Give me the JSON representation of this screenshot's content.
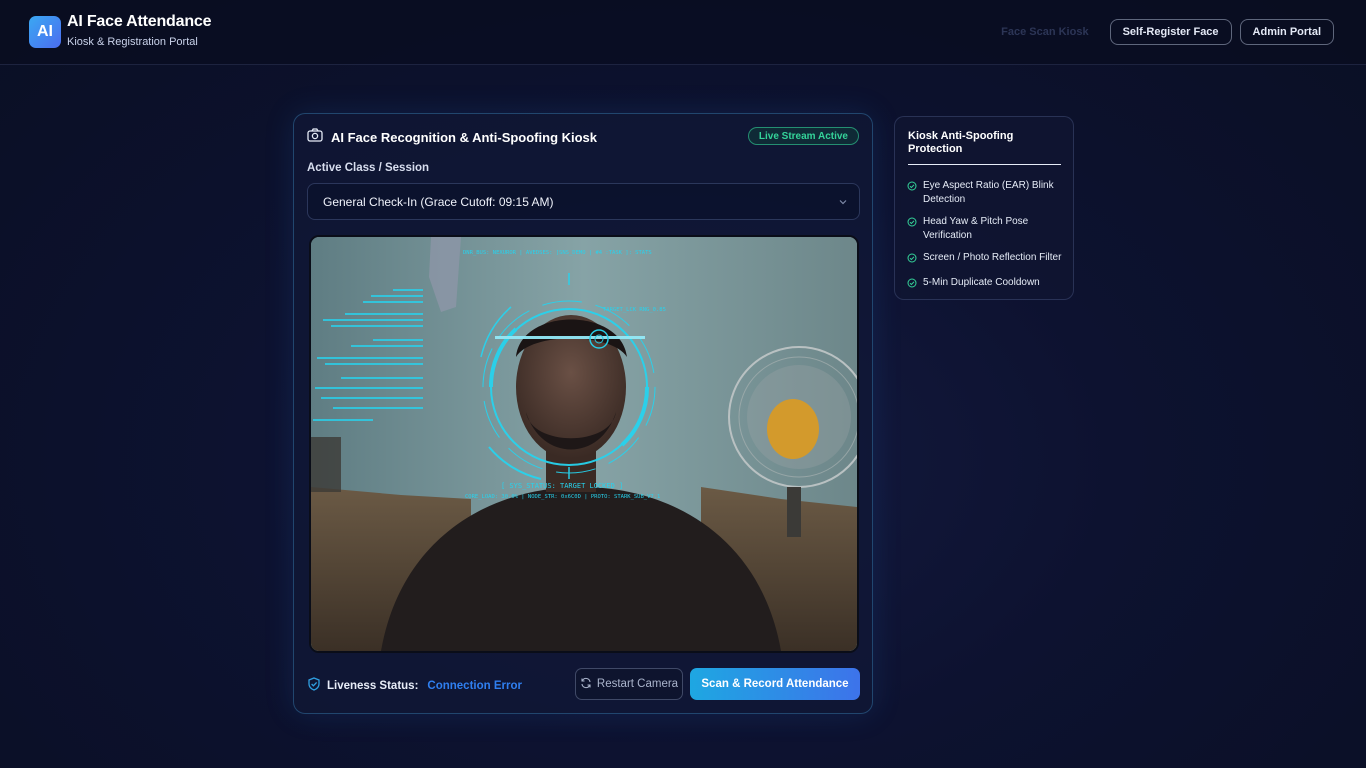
{
  "header": {
    "logo_text": "AI",
    "title": "AI Face Attendance",
    "subtitle": "Kiosk & Registration Portal",
    "nav": [
      {
        "label": "Face Scan Kiosk",
        "active": true
      },
      {
        "label": "Self-Register Face",
        "active": false
      },
      {
        "label": "Admin Portal",
        "active": false
      }
    ]
  },
  "kiosk": {
    "title": "AI Face Recognition & Anti-Spoofing Kiosk",
    "badge": "Live Stream Active",
    "session_label": "Active Class / Session",
    "session_value": "General Check-In (Grace Cutoff: 09:15 AM)",
    "camera": {
      "hud_top": "DNR_BUS: NEXUROR | AVEDSES: [SNS_DEMO | #4 :TASK ]: STATS",
      "hud_status": "[ SYS_STATUS: TARGET LOCKED ]",
      "hud_bottom": "CORE_LOAD: 30.0% | NODE_STR: 0x6C0D | PROTO: STARK_SUB_V7.1",
      "hud_side": "TARGET_LCK  RNG_0.85"
    },
    "liveness_label": "Liveness Status:",
    "liveness_value": "Connection Error",
    "restart_label": "Restart Camera",
    "scan_label": "Scan & Record Attendance"
  },
  "protection": {
    "title": "Kiosk Anti-Spoofing Protection",
    "items": [
      "Eye Aspect Ratio (EAR) Blink Detection",
      "Head Yaw & Pitch Pose Verification",
      "Screen / Photo Reflection Filter",
      "5-Min Duplicate Cooldown"
    ]
  },
  "colors": {
    "accent": "#2f7ff0",
    "success": "#34d399",
    "hud": "#27d3ee"
  }
}
